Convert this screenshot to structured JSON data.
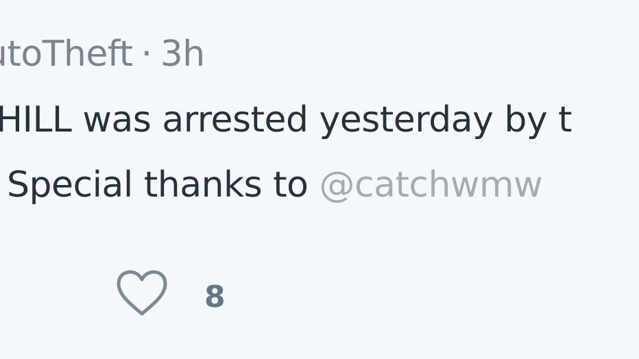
{
  "header": {
    "author_fragment": "utoTheft",
    "separator": "·",
    "timestamp": "3h"
  },
  "body": {
    "line1": "HILL was arrested yesterday by t",
    "line2_prefix": "Special thanks to ",
    "mention": "@catchwmw"
  },
  "actions": {
    "like_icon": "heart-outline-icon",
    "like_count": "8"
  },
  "colors": {
    "background": "#f5f8fa",
    "text": "#26313c",
    "muted": "#7a848e",
    "mention": "#a4acb3",
    "icon": "#657786"
  }
}
